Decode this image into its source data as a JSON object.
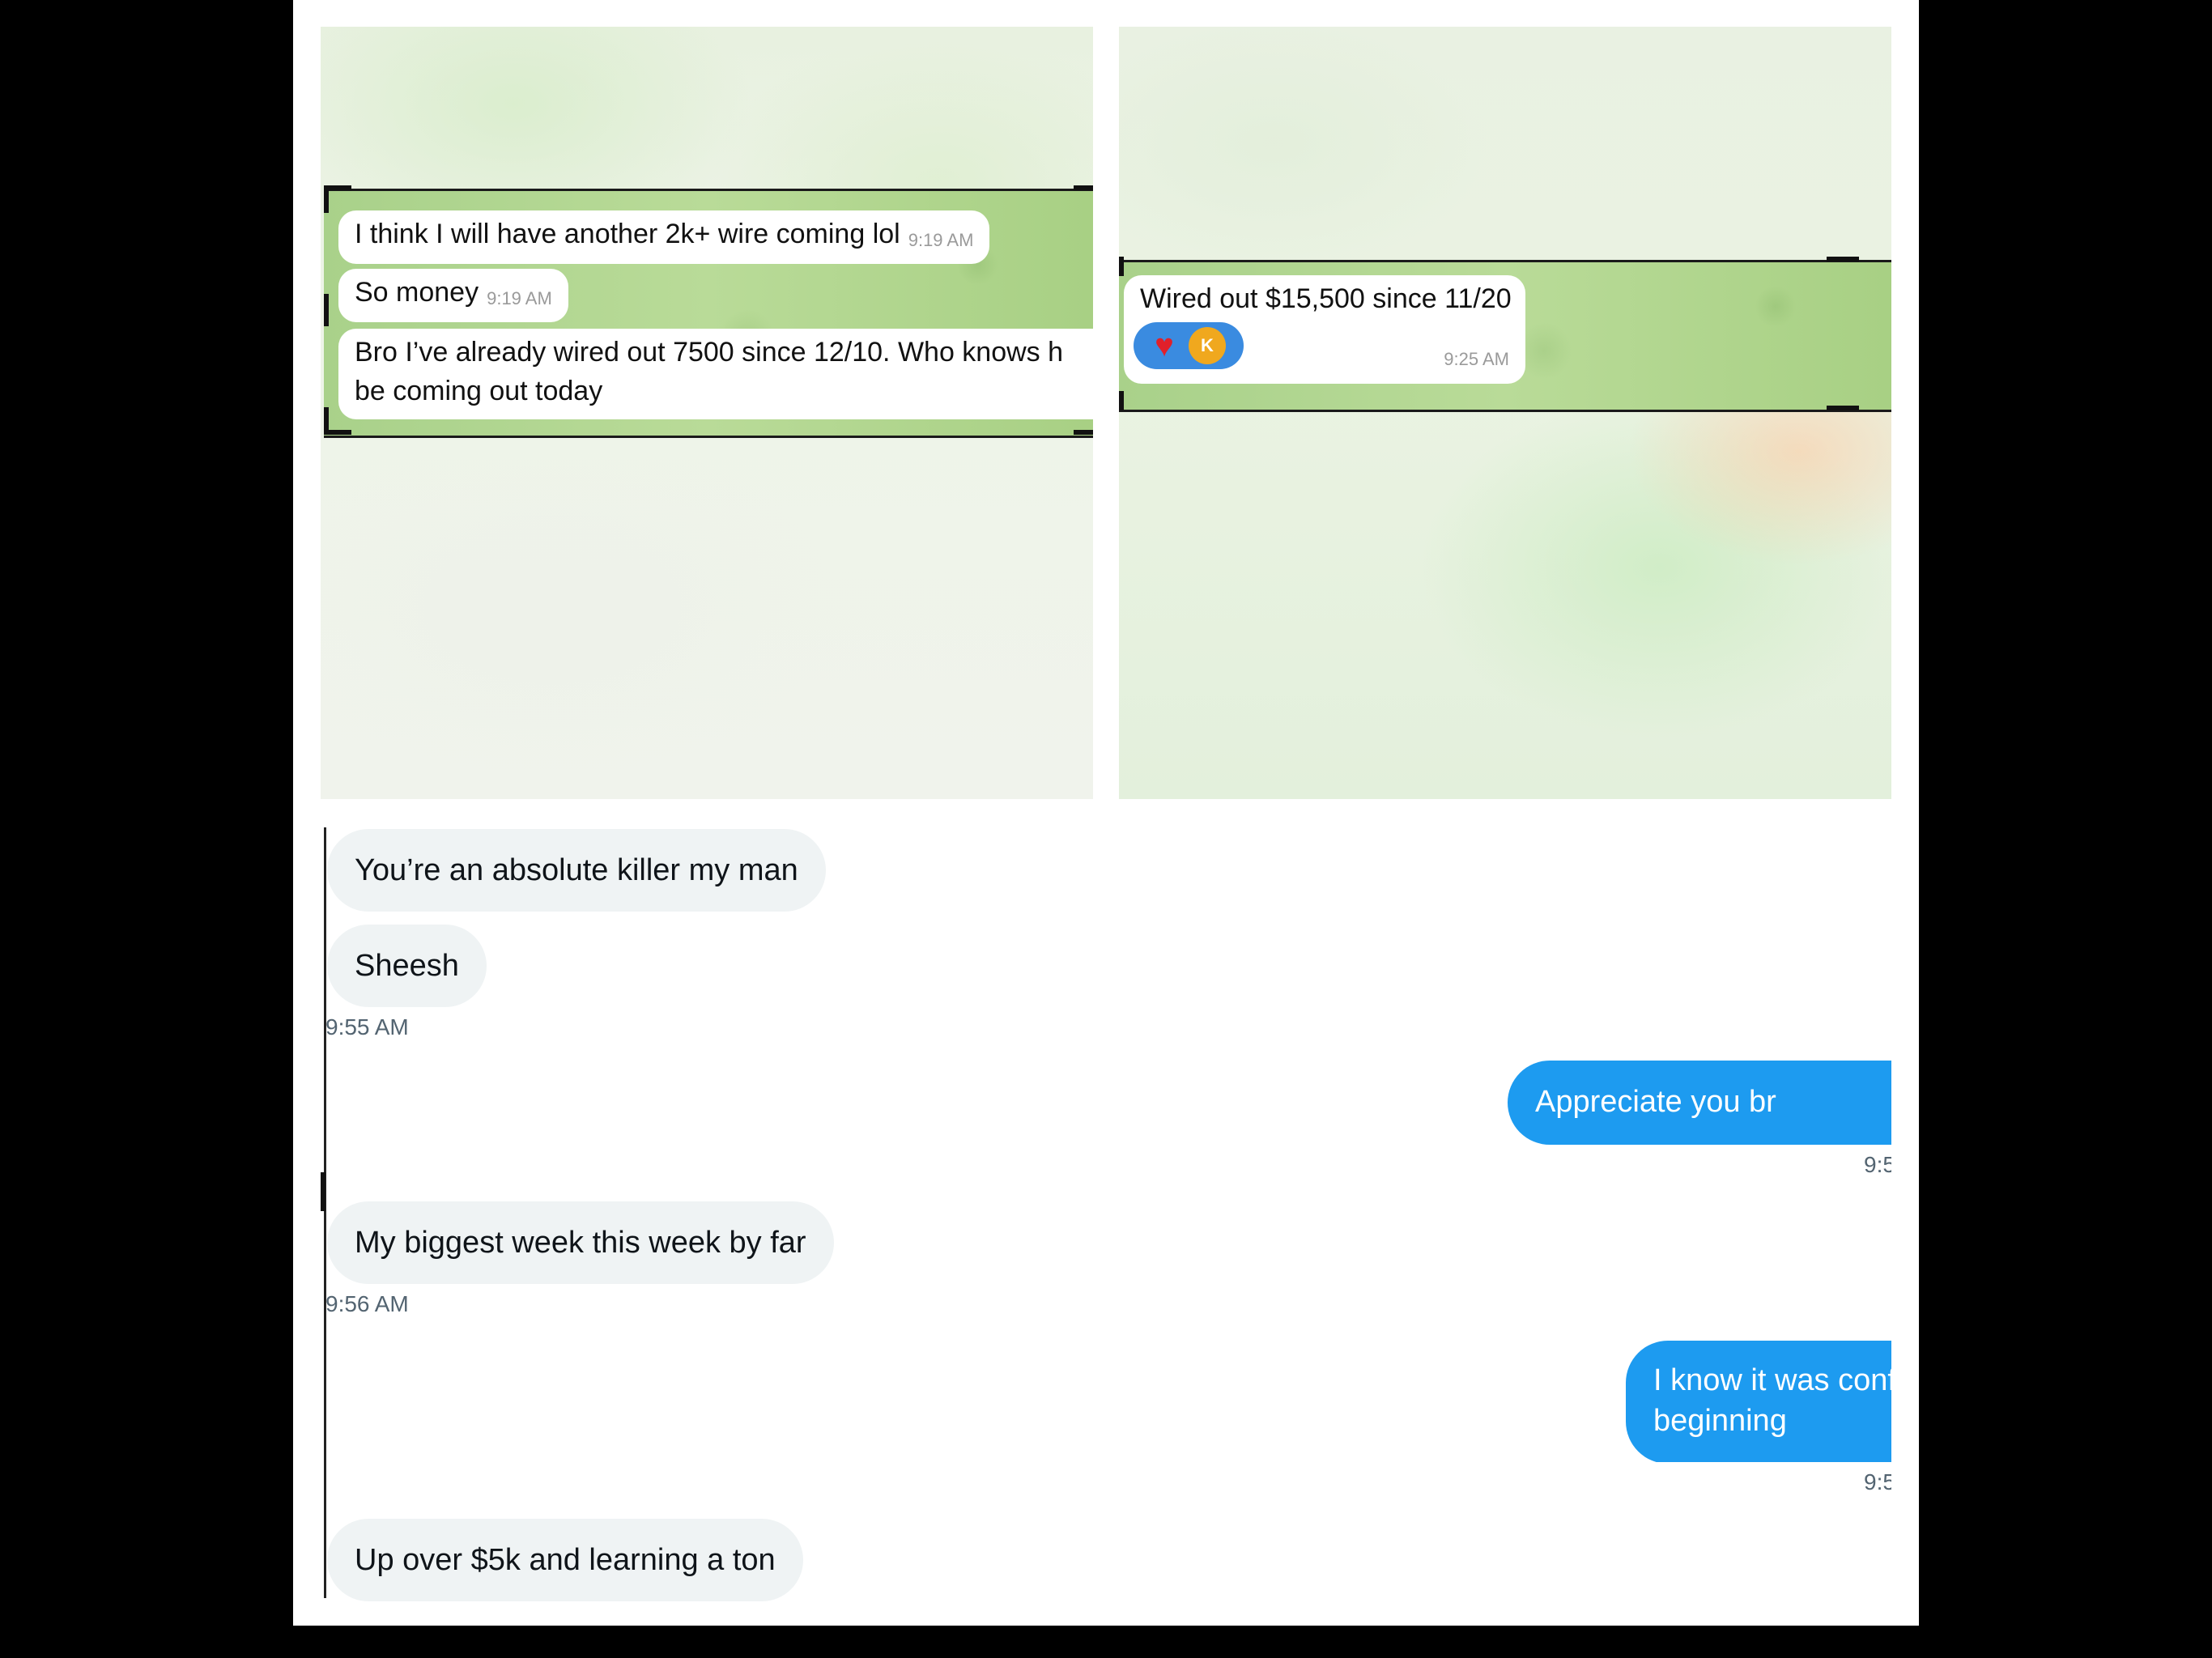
{
  "telegram_left": {
    "messages": [
      {
        "text": "I think I will have another 2k+ wire coming lol",
        "time": "9:19 AM"
      },
      {
        "text": "So money",
        "time": "9:19 AM"
      },
      {
        "text_line1": "Bro I’ve already wired out 7500 since 12/10. Who knows h",
        "text_line2": "be coming out today"
      }
    ]
  },
  "telegram_right": {
    "message": {
      "text": "Wired out $15,500 since 11/20",
      "time": "9:25 AM"
    },
    "reactions": {
      "heart": "heart-reaction",
      "avatar_letter": "K"
    }
  },
  "x_dm": {
    "incoming": [
      {
        "text": "You’re an absolute killer my man"
      },
      {
        "text": "Sheesh"
      },
      {
        "text": "My biggest week this week by far"
      },
      {
        "text": "Up over $5k and learning a ton"
      }
    ],
    "incoming_times": [
      "9:55 AM",
      "9:56 AM"
    ],
    "outgoing": [
      {
        "text": "Appreciate you br"
      },
      {
        "text_line1": "I know it was confusing AF at first in th",
        "text_line2": "beginning"
      }
    ],
    "outgoing_times": [
      "9:5",
      "9:5"
    ]
  },
  "colors": {
    "telegram_green": "#a9d18a",
    "x_blue": "#1d9bf0",
    "x_incoming": "#eff3f4",
    "reaction_blue": "#3a8be0",
    "reaction_avatar": "#f0a81e"
  }
}
